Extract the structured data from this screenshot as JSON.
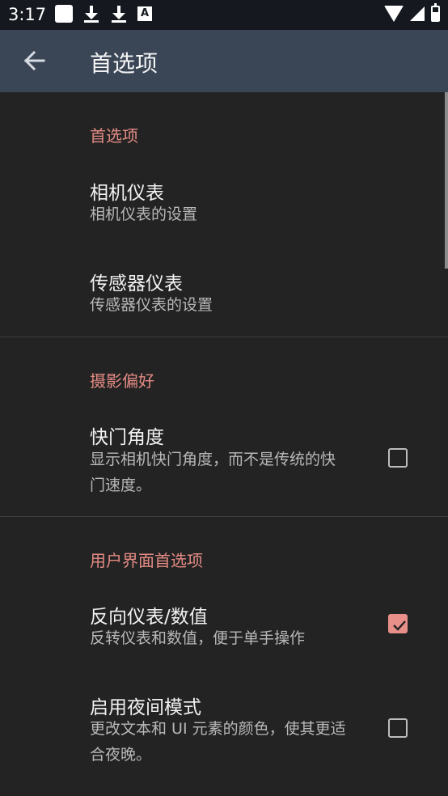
{
  "status_bar": {
    "time": "3:17",
    "left_icons": [
      "square-notification-icon",
      "download-icon",
      "download-icon",
      "a-notification-icon"
    ],
    "right_icons": [
      "wifi-icon",
      "signal-icon",
      "battery-icon"
    ]
  },
  "app_bar": {
    "title": "首选项",
    "back_icon": "arrow-left-icon"
  },
  "sections": [
    {
      "header": "首选项",
      "items": [
        {
          "title": "相机仪表",
          "summary": "相机仪表的设置"
        },
        {
          "title": "传感器仪表",
          "summary": "传感器仪表的设置"
        }
      ]
    },
    {
      "header": "摄影偏好",
      "items": [
        {
          "title": "快门角度",
          "summary": "显示相机快门角度，而不是传统的快门速度。",
          "checked": false
        }
      ]
    },
    {
      "header": "用户界面首选项",
      "items": [
        {
          "title": "反向仪表/数值",
          "summary": "反转仪表和数值，便于单手操作",
          "checked": true
        },
        {
          "title": "启用夜间模式",
          "summary": "更改文本和 UI 元素的颜色，使其更适合夜晚。",
          "checked": false
        }
      ]
    }
  ],
  "colors": {
    "accent": "#e88f8a",
    "app_bar": "#3a4556",
    "background": "#232323"
  }
}
